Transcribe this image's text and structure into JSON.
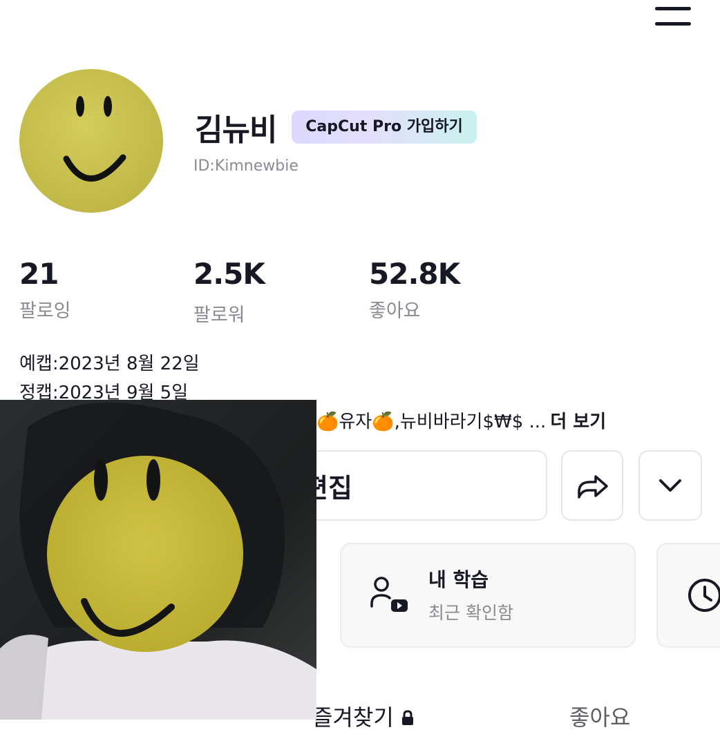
{
  "header": {
    "menu_icon": "hamburger-menu-icon"
  },
  "profile": {
    "avatar_icon": "smiley-face-avatar",
    "username": "김뉴비",
    "pro_badge": "CapCut Pro 가입하기",
    "user_id": "ID:Kimnewbie"
  },
  "stats": [
    {
      "value": "21",
      "label": "팔로잉"
    },
    {
      "value": "2.5K",
      "label": "팔로워"
    },
    {
      "value": "52.8K",
      "label": "좋아요"
    }
  ],
  "bio": {
    "lines": [
      "예캡:2023년 8월 22일",
      "정캡:2023년 9월 5일"
    ],
    "truncated": "🍊유자🍊,뉴비바라기$₩$ ...",
    "more_label": "더 보기"
  },
  "actions": {
    "edit_label": "편집",
    "share_icon": "share-arrow-icon",
    "more_icon": "chevron-down-icon"
  },
  "cards": [
    {
      "icon": "person-play-icon",
      "title": "내 학습",
      "subtitle": "최근 확인함"
    },
    {
      "icon": "clock-icon"
    }
  ],
  "tabs": [
    {
      "label": "즐겨찾기",
      "icon": "lock-icon"
    },
    {
      "label": "좋아요"
    }
  ],
  "colors": {
    "text_primary": "#161823",
    "text_secondary": "#8a8b91",
    "avatar_yellow": "#c9c14f",
    "badge_gradient_start": "#dcd8ff",
    "badge_gradient_end": "#c9f2ef"
  }
}
